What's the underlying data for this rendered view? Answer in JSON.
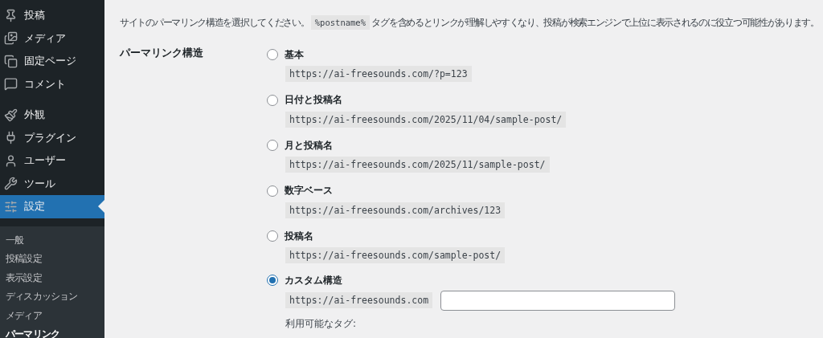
{
  "sidebar": {
    "groups": [
      {
        "items": [
          {
            "label": "投稿",
            "selected": false
          },
          {
            "label": "メディア",
            "selected": false
          },
          {
            "label": "固定ページ",
            "selected": false
          },
          {
            "label": "コメント",
            "selected": false
          }
        ]
      },
      {
        "items": [
          {
            "label": "外観",
            "selected": false
          },
          {
            "label": "プラグイン",
            "selected": false
          },
          {
            "label": "ユーザー",
            "selected": false
          },
          {
            "label": "ツール",
            "selected": false
          },
          {
            "label": "設定",
            "selected": true
          }
        ]
      }
    ],
    "submenu": [
      {
        "label": "一般",
        "selected": false
      },
      {
        "label": "投稿設定",
        "selected": false
      },
      {
        "label": "表示設定",
        "selected": false
      },
      {
        "label": "ディスカッション",
        "selected": false
      },
      {
        "label": "メディア",
        "selected": false
      },
      {
        "label": "パーマリンク",
        "selected": true
      }
    ]
  },
  "description": {
    "before": "サイトのパーマリンク構造を選択してください。",
    "code": "%postname%",
    "after": "タグを含めるとリンクが理解しやすくなり、投稿が検索エンジンで上位に表示されるのに役立つ可能性があります。"
  },
  "permalink": {
    "label": "パーマリンク構造",
    "options": [
      {
        "label": "基本",
        "example": "https://ai-freesounds.com/?p=123",
        "selected": false,
        "kind": "preset"
      },
      {
        "label": "日付と投稿名",
        "example": "https://ai-freesounds.com/2025/11/04/sample-post/",
        "selected": false,
        "kind": "preset"
      },
      {
        "label": "月と投稿名",
        "example": "https://ai-freesounds.com/2025/11/sample-post/",
        "selected": false,
        "kind": "preset"
      },
      {
        "label": "数字ベース",
        "example": "https://ai-freesounds.com/archives/123",
        "selected": false,
        "kind": "preset"
      },
      {
        "label": "投稿名",
        "example": "https://ai-freesounds.com/sample-post/",
        "selected": false,
        "kind": "preset"
      },
      {
        "label": "カスタム構造",
        "example": "https://ai-freesounds.com",
        "selected": true,
        "kind": "custom"
      }
    ],
    "tags_label": "利用可能なタグ:"
  }
}
